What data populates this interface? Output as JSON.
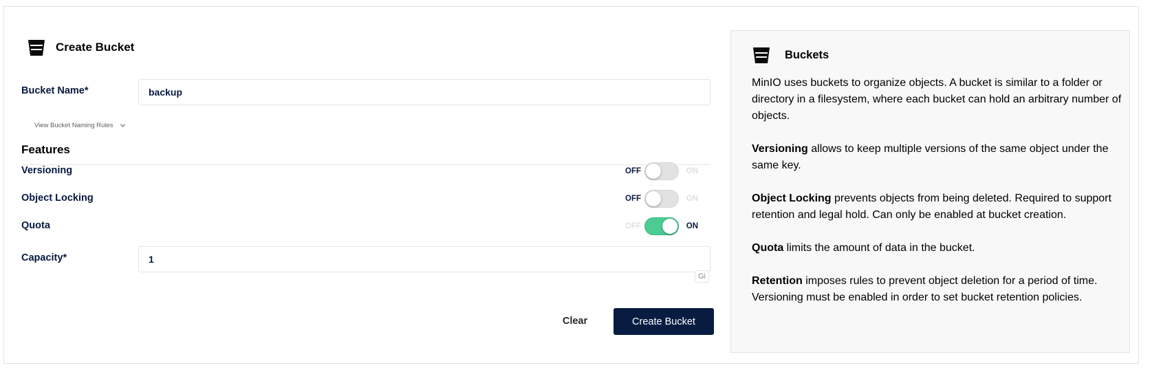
{
  "form": {
    "title": "Create Bucket",
    "bucket_name_label": "Bucket Name*",
    "bucket_name_value": "backup",
    "naming_rules_link": "View Bucket Naming Rules",
    "features_title": "Features",
    "toggles": {
      "off_text": "OFF",
      "on_text": "ON",
      "versioning": {
        "label": "Versioning",
        "on": false
      },
      "object_locking": {
        "label": "Object Locking",
        "on": false
      },
      "quota": {
        "label": "Quota",
        "on": true
      }
    },
    "capacity_label": "Capacity*",
    "capacity_value": "1",
    "capacity_unit": "Gi",
    "clear_button": "Clear",
    "create_button": "Create Bucket"
  },
  "help": {
    "title": "Buckets",
    "intro": "MinIO uses buckets to organize objects. A bucket is similar to a folder or directory in a filesystem, where each bucket can hold an arbitrary number of objects.",
    "items": [
      {
        "term": "Versioning",
        "text": " allows to keep multiple versions of the same object under the same key."
      },
      {
        "term": "Object Locking",
        "text": " prevents objects from being deleted. Required to support retention and legal hold. Can only be enabled at bucket creation."
      },
      {
        "term": "Quota",
        "text": " limits the amount of data in the bucket."
      },
      {
        "term": "Retention",
        "text": " imposes rules to prevent object deletion for a period of time. Versioning must be enabled in order to set bucket retention policies."
      }
    ]
  },
  "icons": {
    "form_title_icon": "bucket-icon",
    "help_title_icon": "bucket-icon",
    "naming_rules_icon": "chevron-down-icon"
  },
  "colors": {
    "primary": "#081c42",
    "label_text": "#07193e",
    "toggle_on": "#4ccb92",
    "toggle_off": "#e2e2e2",
    "panel_bg": "#f8f8f8"
  }
}
